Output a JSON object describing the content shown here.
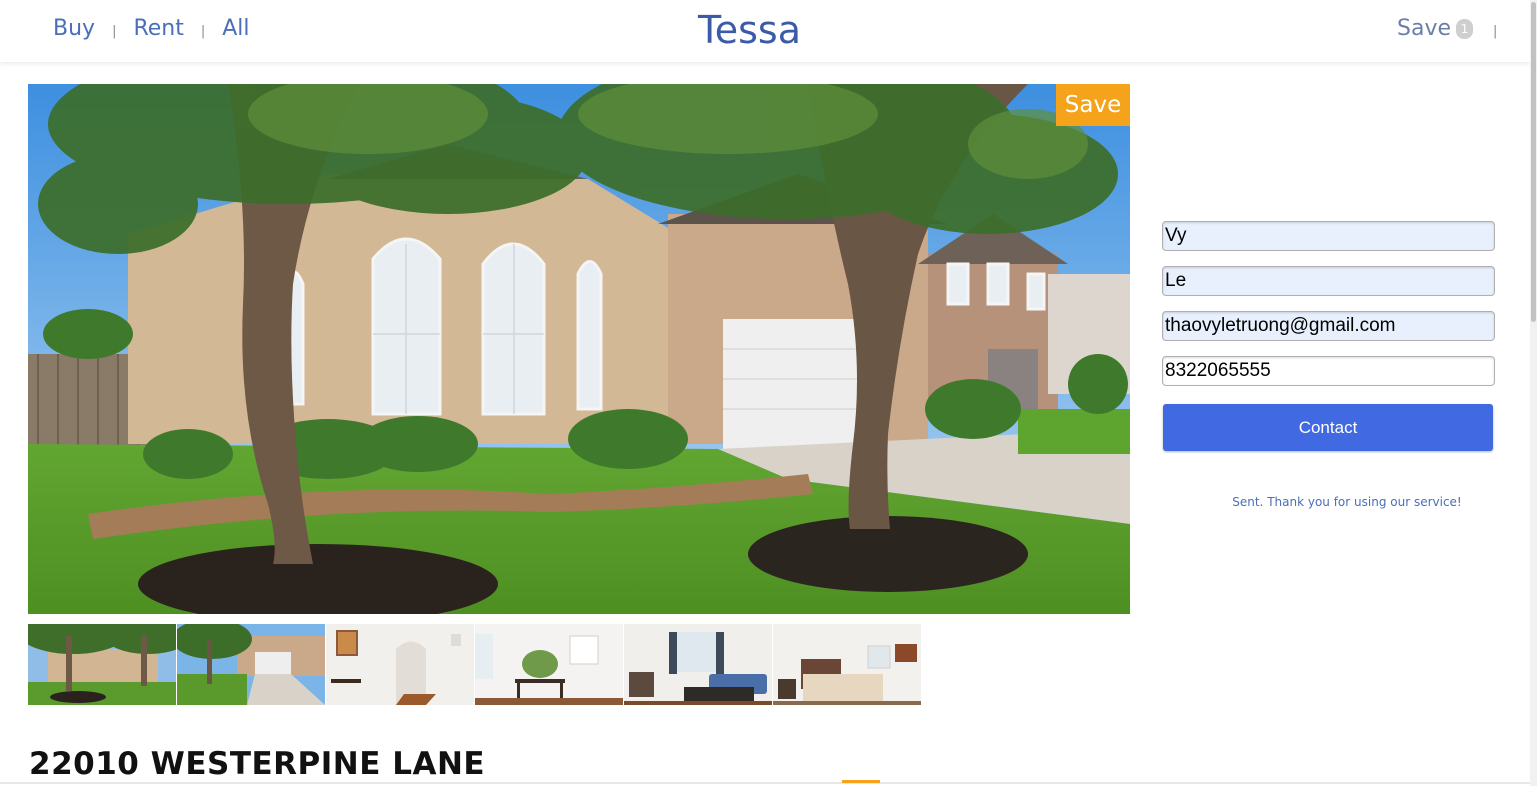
{
  "header": {
    "nav": [
      {
        "label": "Buy"
      },
      {
        "label": "Rent"
      },
      {
        "label": "All"
      }
    ],
    "separator": "|",
    "brand": "Tessa",
    "save_label": "Save",
    "save_count": "1"
  },
  "listing": {
    "save_badge": "Save",
    "address": "22010 WESTERPINE LANE",
    "thumbnails": [
      {
        "name": "exterior-front"
      },
      {
        "name": "exterior-driveway"
      },
      {
        "name": "interior-entry"
      },
      {
        "name": "interior-dining"
      },
      {
        "name": "interior-living"
      },
      {
        "name": "interior-bedroom"
      }
    ]
  },
  "contact_form": {
    "first_name": "Vy",
    "last_name": "Le",
    "email": "thaovyletruong@gmail.com",
    "phone": "8322065555",
    "button_label": "Contact",
    "status_message": "Sent. Thank you for using our service!"
  },
  "colors": {
    "brand": "#3b5aa8",
    "nav": "#4a6fb8",
    "save_badge": "#f5a31a",
    "button": "#4169e1",
    "autofill": "#e8f0fe"
  }
}
